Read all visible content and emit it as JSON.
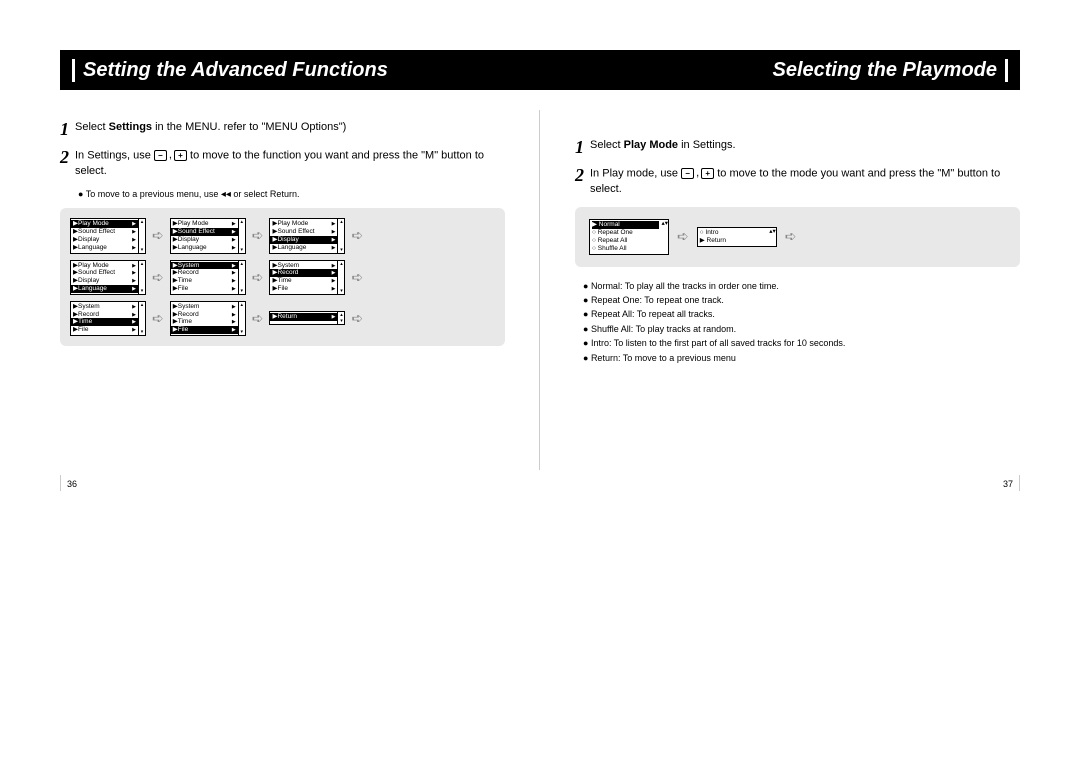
{
  "header": {
    "title_left": "Setting the Advanced Functions",
    "title_right": "Selecting the Playmode"
  },
  "left": {
    "step1_pre": "Select ",
    "step1_bold": "Settings",
    "step1_post": " in the MENU. refer to \"MENU Options\")",
    "step2_pre": "In Settings, use ",
    "step2_post": " to move to the function you want and press the \"M\" button to select.",
    "note_pre": "To move to a previous menu, use ",
    "note_post": " or select Return.",
    "screens": {
      "row1": [
        {
          "lines": [
            {
              "t": "▶Play Mode",
              "sel": true,
              "tri": true
            },
            {
              "t": "▶Sound Effect",
              "tri": true
            },
            {
              "t": "▶Display",
              "tri": true
            },
            {
              "t": "▶Language",
              "tri": true
            }
          ]
        },
        {
          "lines": [
            {
              "t": "▶Play Mode",
              "tri": true
            },
            {
              "t": "▶Sound Effect",
              "sel": true,
              "tri": true
            },
            {
              "t": "▶Display",
              "tri": true
            },
            {
              "t": "▶Language",
              "tri": true
            }
          ]
        },
        {
          "lines": [
            {
              "t": "▶Play Mode",
              "tri": true
            },
            {
              "t": "▶Sound Effect",
              "tri": true
            },
            {
              "t": "▶Display",
              "sel": true,
              "tri": true
            },
            {
              "t": "▶Language",
              "tri": true
            }
          ]
        }
      ],
      "row2": [
        {
          "lines": [
            {
              "t": "▶Play Mode",
              "tri": true
            },
            {
              "t": "▶Sound Effect",
              "tri": true
            },
            {
              "t": "▶Display",
              "tri": true
            },
            {
              "t": "▶Language",
              "sel": true,
              "tri": true
            }
          ]
        },
        {
          "lines": [
            {
              "t": "▶System",
              "sel": true,
              "tri": true
            },
            {
              "t": "▶Record",
              "tri": true
            },
            {
              "t": "▶Time",
              "tri": true
            },
            {
              "t": "▶File",
              "tri": true
            }
          ]
        },
        {
          "lines": [
            {
              "t": "▶System",
              "tri": true
            },
            {
              "t": "▶Record",
              "sel": true,
              "tri": true
            },
            {
              "t": "▶Time",
              "tri": true
            },
            {
              "t": "▶File",
              "tri": true
            }
          ]
        }
      ],
      "row3": [
        {
          "lines": [
            {
              "t": "▶System",
              "tri": true
            },
            {
              "t": "▶Record",
              "tri": true
            },
            {
              "t": "▶Time",
              "sel": true,
              "tri": true
            },
            {
              "t": "▶File",
              "tri": true
            }
          ]
        },
        {
          "lines": [
            {
              "t": "▶System",
              "tri": true
            },
            {
              "t": "▶Record",
              "tri": true
            },
            {
              "t": "▶Time",
              "tri": true
            },
            {
              "t": "▶File",
              "sel": true,
              "tri": true
            }
          ]
        },
        {
          "lines": [
            {
              "t": "▶Return",
              "sel": true,
              "tri": true
            },
            {
              "t": " "
            },
            {
              "t": " "
            },
            {
              "t": " "
            }
          ]
        }
      ]
    },
    "pagenum": "36"
  },
  "right": {
    "step1_pre": "Select ",
    "step1_bold": "Play Mode",
    "step1_post": " in Settings.",
    "step2_pre": "In Play mode, use ",
    "step2_post": " to move to the mode you want and press the \"M\" button to select.",
    "screen_left_col": [
      "▶ Normal",
      "○ Repeat One",
      "○ Repeat All",
      "○ Shuffle All"
    ],
    "screen_left_sel_index": 0,
    "screen_right_col": [
      "○ Intro",
      "▶ Return"
    ],
    "bullets": [
      "Normal: To play all the tracks in order one time.",
      "Repeat One: To repeat one track.",
      "Repeat All: To repeat all tracks.",
      "Shuffle All: To play tracks at random.",
      "Intro: To listen to the first part of all saved tracks for 10 seconds.",
      "Return: To move to a previous menu"
    ],
    "pagenum": "37"
  },
  "icons": {
    "minus": "−",
    "plus": "+",
    "comma": ",",
    "rewind": "◂◂"
  }
}
